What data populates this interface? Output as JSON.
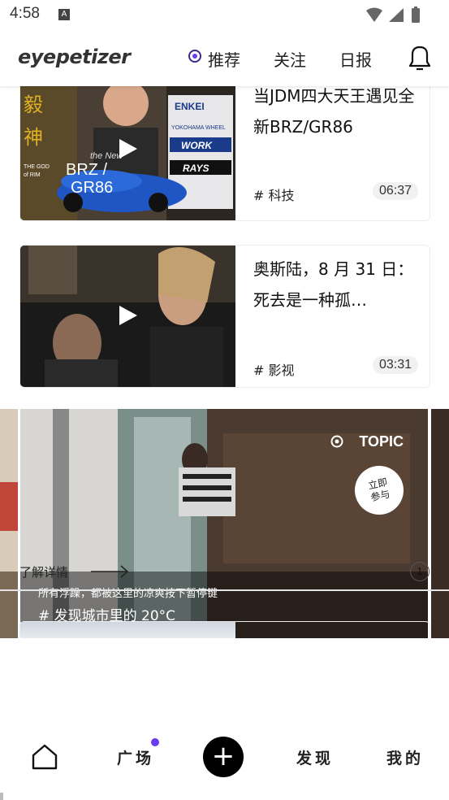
{
  "status_bar": {
    "time": "4:58",
    "notification_icon_letter": "A",
    "icons": [
      "wifi-icon",
      "signal-icon",
      "battery-icon"
    ]
  },
  "header": {
    "logo": "eyepetizer",
    "tabs": [
      {
        "label": "推荐",
        "active": true,
        "icon": "dot-circle-icon"
      },
      {
        "label": "关注",
        "active": false
      },
      {
        "label": "日报",
        "active": false
      }
    ],
    "bell_icon": "bell-icon"
  },
  "cards": [
    {
      "title": "当JDM四大天王遇见全新BRZ/GR86",
      "tag": "# 科技",
      "duration": "06:37",
      "thumb_text": {
        "left_big": "毅神",
        "left_small": "THE GOD of RIM",
        "car_line1": "BRZ /",
        "car_line2": "GR86",
        "new_label": "the New",
        "brands": [
          "ENKEI",
          "YOKOHAMA WHEEL",
          "WORK",
          "RAYS"
        ]
      }
    },
    {
      "title": "奥斯陆，8 月 31 日：死去是一种孤…",
      "tag": "# 影视",
      "duration": "03:31"
    }
  ],
  "banner": {
    "topic_label": "TOPIC",
    "join_label": "立即参与",
    "subtitle": "所有浮躁，都被这里的凉爽按下暂停键",
    "hashtag": "#  发现城市里的 20°C"
  },
  "learn_more": {
    "label": "了解详情",
    "page_number": "1"
  },
  "bottom_nav": {
    "items": [
      {
        "label": "",
        "icon": "home-icon"
      },
      {
        "label": "广场"
      },
      {
        "label": "",
        "icon": "plus-icon"
      },
      {
        "label": "发现"
      },
      {
        "label": "我的"
      }
    ],
    "accent_color": "#6a3cf0"
  }
}
